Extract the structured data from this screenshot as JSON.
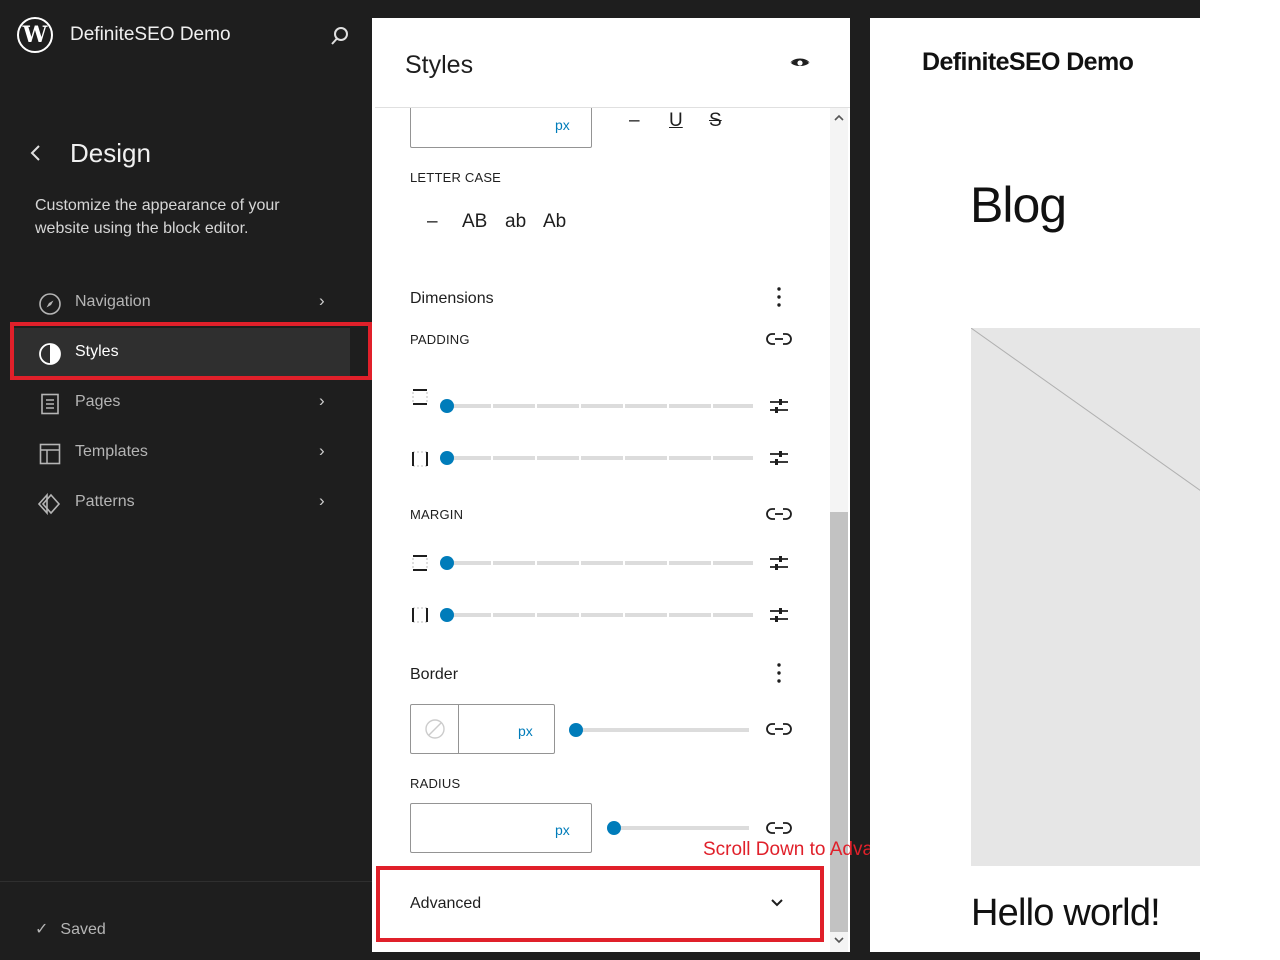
{
  "sidebar": {
    "site_title": "DefiniteSEO Demo",
    "section_title": "Design",
    "description": "Customize the appearance of your website using the block editor.",
    "items": [
      {
        "label": "Navigation",
        "icon": "compass-icon"
      },
      {
        "label": "Styles",
        "icon": "contrast-icon"
      },
      {
        "label": "Pages",
        "icon": "page-icon"
      },
      {
        "label": "Templates",
        "icon": "layout-icon"
      },
      {
        "label": "Patterns",
        "icon": "symbol-icon"
      }
    ],
    "status": "Saved"
  },
  "panel": {
    "title": "Styles",
    "typography": {
      "unit": "px",
      "decoration_options": [
        "–",
        "U",
        "S"
      ],
      "letter_case_label": "LETTER CASE",
      "letter_case_options": [
        "–",
        "AB",
        "ab",
        "Ab"
      ]
    },
    "dimensions": {
      "title": "Dimensions",
      "padding_label": "PADDING",
      "margin_label": "MARGIN"
    },
    "border": {
      "title": "Border",
      "unit": "px",
      "radius_label": "RADIUS",
      "radius_unit": "px"
    },
    "advanced": {
      "label": "Advanced"
    }
  },
  "annotation": "Scroll Down to Advance",
  "preview": {
    "site_title": "DefiniteSEO Demo",
    "heading": "Blog",
    "post_title": "Hello world!"
  },
  "colors": {
    "sidebar_bg": "#1e1e1e",
    "accent": "#007cba",
    "highlight": "#e0202a"
  }
}
